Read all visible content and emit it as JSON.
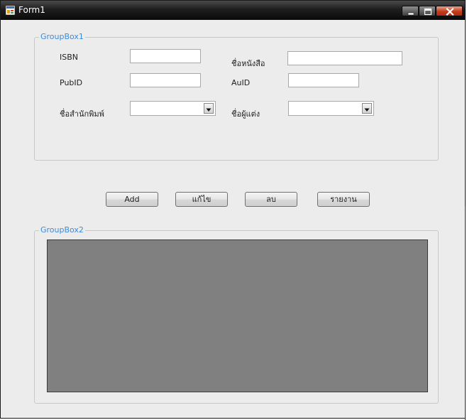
{
  "window": {
    "title": "Form1"
  },
  "groupbox1": {
    "legend": "GroupBox1",
    "isbn_label": "ISBN",
    "book_name_label": "ชื่อหนังสือ",
    "pubid_label": "PubID",
    "auid_label": "AuID",
    "publisher_name_label": "ชื่อสำนักพิมพ์",
    "author_name_label": "ชื่อผู้แต่ง",
    "isbn_value": "",
    "book_name_value": "",
    "pubid_value": "",
    "auid_value": "",
    "publisher_selected": "",
    "author_selected": ""
  },
  "buttons": {
    "add": "Add",
    "edit": "แก้ไข",
    "delete": "ลบ",
    "report": "รายงาน"
  },
  "groupbox2": {
    "legend": "GroupBox2"
  },
  "colors": {
    "legend": "#3c8bd9",
    "client_bg": "#ececec",
    "grid_bg": "#808080"
  },
  "icons": [
    "app-icon",
    "minimize-icon",
    "maximize-icon",
    "close-icon",
    "dropdown-arrow-icon"
  ]
}
